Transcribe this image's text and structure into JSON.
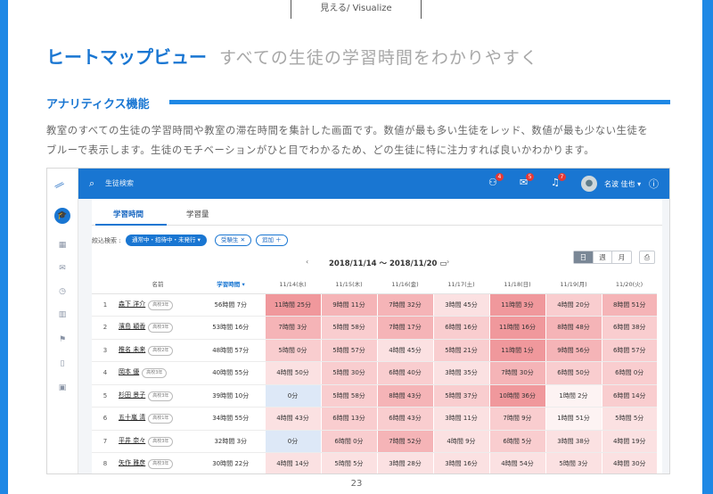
{
  "header": {
    "tab_label": "見える/ Visualize"
  },
  "title": {
    "main": "ヒートマップビュー",
    "sub": "すべての生徒の学習時間をわかりやすく"
  },
  "section": {
    "title": "アナリティクス機能"
  },
  "description": {
    "line1": "教室のすべての生徒の学習時間や教室の滞在時間を集計した画面です。数値が最も多い生徒をレッド、数値が最も少ない生徒を",
    "line2": "ブルーで表示します。生徒のモチベーションがひと目でわかるため、どの生徒に特に注力すれば良いかわかります。"
  },
  "app": {
    "search_placeholder": "生徒検索",
    "badges": {
      "users": "4",
      "messages": "5",
      "notifications": "7"
    },
    "user_name": "名波 佳也",
    "tabs": [
      "学習時間",
      "学習量"
    ],
    "filter_label": "絞込検索 :",
    "chips": [
      "通常中・招待中・未発行",
      "受験生",
      "追加"
    ],
    "date_range": "2018/11/14 〜 2018/11/20",
    "period_buttons": [
      "日",
      "週",
      "月"
    ],
    "period_selected": "日",
    "columns": {
      "name": "名前",
      "total": "学習時間",
      "days": [
        "11/14(水)",
        "11/15(木)",
        "11/16(金)",
        "11/17(土)",
        "11/18(日)",
        "11/19(月)",
        "11/20(火)"
      ]
    },
    "rows": [
      {
        "no": "1",
        "name": "森下 洋介",
        "grade": "高校3年",
        "total": "56時間 7分",
        "cells": [
          "11時間 25分",
          "9時間 11分",
          "7時間 32分",
          "3時間 45分",
          "11時間 3分",
          "4時間 20分",
          "8時間 51分"
        ]
      },
      {
        "no": "2",
        "name": "濱島 穎香",
        "grade": "高校3年",
        "total": "53時間 16分",
        "cells": [
          "7時間 3分",
          "5時間 58分",
          "7時間 17分",
          "6時間 16分",
          "11時間 16分",
          "8時間 48分",
          "6時間 38分"
        ]
      },
      {
        "no": "3",
        "name": "椎名 未来",
        "grade": "高校2年",
        "total": "48時間 57分",
        "cells": [
          "5時間 0分",
          "5時間 57分",
          "4時間 45分",
          "5時間 21分",
          "11時間 1分",
          "9時間 56分",
          "6時間 57分"
        ]
      },
      {
        "no": "4",
        "name": "岡本 優",
        "grade": "高校3年",
        "total": "40時間 55分",
        "cells": [
          "4時間 50分",
          "5時間 30分",
          "6時間 40分",
          "3時間 35分",
          "7時間 30分",
          "6時間 50分",
          "6時間 0分"
        ]
      },
      {
        "no": "5",
        "name": "杉田 景子",
        "grade": "高校3年",
        "total": "39時間 10分",
        "cells": [
          "0分",
          "5時間 58分",
          "8時間 43分",
          "5時間 37分",
          "10時間 36分",
          "1時間 2分",
          "6時間 14分"
        ]
      },
      {
        "no": "6",
        "name": "五十嵐 清",
        "grade": "高校1年",
        "total": "34時間 55分",
        "cells": [
          "4時間 43分",
          "6時間 13分",
          "6時間 43分",
          "3時間 11分",
          "7時間 9分",
          "1時間 51分",
          "5時間 5分"
        ]
      },
      {
        "no": "7",
        "name": "平井 奈々",
        "grade": "高校3年",
        "total": "32時間 3分",
        "cells": [
          "0分",
          "6時間 0分",
          "7時間 52分",
          "4時間 9分",
          "6時間 5分",
          "3時間 38分",
          "4時間 19分"
        ]
      },
      {
        "no": "8",
        "name": "矢作 雅彦",
        "grade": "高校3年",
        "total": "30時間 22分",
        "cells": [
          "4時間 14分",
          "5時間 5分",
          "3時間 28分",
          "3時間 16分",
          "4時間 54分",
          "5時間 3分",
          "4時間 30分"
        ]
      }
    ],
    "heat_levels": [
      [
        5,
        4,
        4,
        2,
        5,
        3,
        4
      ],
      [
        4,
        3,
        4,
        3,
        5,
        4,
        3
      ],
      [
        3,
        3,
        2,
        3,
        5,
        4,
        3
      ],
      [
        2,
        3,
        3,
        2,
        4,
        3,
        3
      ],
      [
        0,
        3,
        4,
        3,
        5,
        1,
        3
      ],
      [
        2,
        3,
        3,
        2,
        3,
        1,
        2
      ],
      [
        0,
        3,
        4,
        2,
        3,
        2,
        2
      ],
      [
        2,
        2,
        2,
        2,
        2,
        2,
        2
      ]
    ],
    "heat_colors": [
      "#dde8f7",
      "#fdf3f3",
      "#fbe1e2",
      "#f9cdcf",
      "#f5b4b7",
      "#f0989c"
    ]
  },
  "footer": {
    "page_number": "23"
  }
}
